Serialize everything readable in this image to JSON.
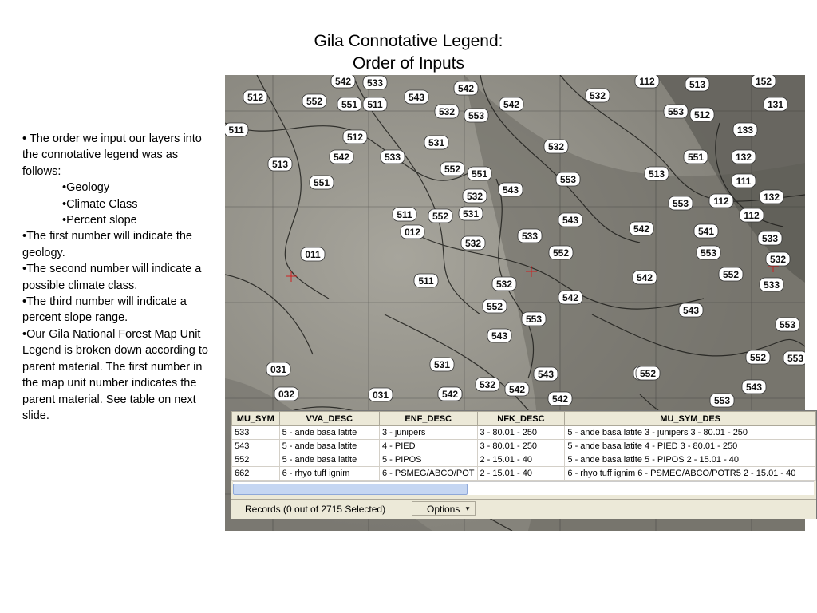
{
  "slide": {
    "title_line1": "Gila Connotative Legend:",
    "title_line2": "Order of Inputs",
    "bullets": [
      "• The order we input our layers into the connotative legend was as follows:",
      "•Geology",
      "•Climate Class",
      "•Percent slope",
      "•The first number will indicate the geology.",
      "•The second number will indicate a possible climate class.",
      "•The third number will indicate a percent slope range.",
      "•Our Gila National Forest Map Unit Legend is broken down according to parent material.  The first number in the map unit number indicates the parent material.  See table on next slide."
    ]
  },
  "map": {
    "labels": [
      "542",
      "533",
      "512",
      "552",
      "551",
      "511",
      "543",
      "542",
      "532",
      "553",
      "112",
      "152",
      "513",
      "512",
      "131",
      "532",
      "542",
      "553",
      "133",
      "551",
      "513",
      "132",
      "111",
      "511",
      "512",
      "542",
      "533",
      "531",
      "552",
      "551",
      "532",
      "532",
      "543",
      "553",
      "513",
      "551",
      "112",
      "132",
      "112",
      "553",
      "511",
      "552",
      "531",
      "012",
      "543",
      "533",
      "542",
      "541",
      "533",
      "532",
      "011",
      "532",
      "552",
      "533",
      "553",
      "552",
      "542",
      "511",
      "532",
      "552",
      "542",
      "553",
      "543",
      "543",
      "553",
      "031",
      "531",
      "552",
      "553",
      "543",
      "552",
      "542",
      "032",
      "031",
      "542",
      "532",
      "542",
      "542",
      "543",
      "553",
      "552"
    ]
  },
  "attribute_table": {
    "columns": [
      "MU_SYM",
      "VVA_DESC",
      "ENF_DESC",
      "NFK_DESC",
      "MU_SYM_DES"
    ],
    "rows": [
      [
        "533",
        "5 - ande basa latite",
        "3 - junipers",
        "3 - 80.01 - 250",
        "5 - ande basa latite 3 - junipers 3 - 80.01 - 250"
      ],
      [
        "543",
        "5 - ande basa latite",
        "4 - PIED",
        "3 - 80.01 - 250",
        "5 - ande basa latite 4 - PIED 3 - 80.01 - 250"
      ],
      [
        "552",
        "5 - ande basa latite",
        "5 - PIPOS",
        "2 - 15.01 - 40",
        "5 - ande basa latite 5 - PIPOS 2 - 15.01 - 40"
      ],
      [
        "662",
        "6 - rhyo tuff ignim",
        "6 - PSMEG/ABCO/POT",
        "2 - 15.01 - 40",
        "6 - rhyo tuff ignim 6 - PSMEG/ABCO/POTR5 2 - 15.01 - 40"
      ]
    ],
    "records_text": "Records (0 out of 2715 Selected)",
    "options_label": "Options"
  }
}
